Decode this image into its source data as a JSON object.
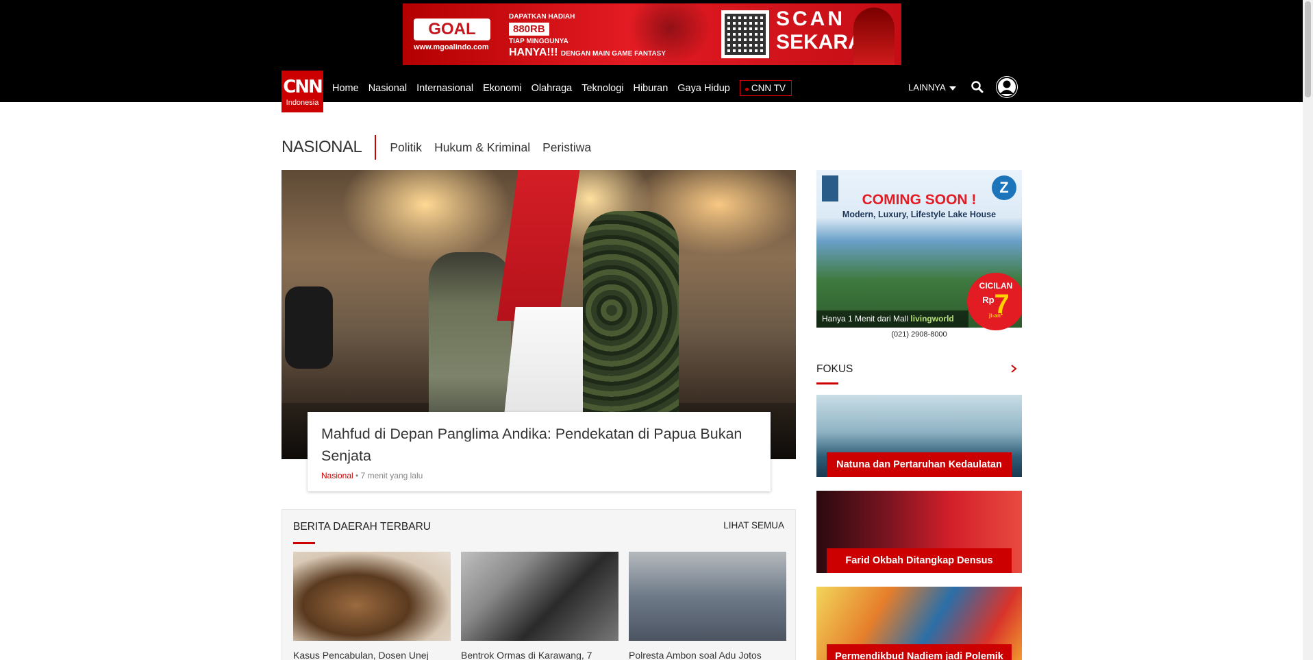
{
  "ad_top": {
    "logo": "GOAL",
    "site": "www.mgoalindo.com",
    "line1": "DAPATKAN HADIAH",
    "amount": "880RB",
    "line2": "TIAP MINGGUNYA",
    "line3": "HANYA!!!",
    "line3_small": "DENGAN MAIN GAME FANTASY",
    "scan": "SCAN",
    "sekarang": "SEKARANG"
  },
  "nav": {
    "logo_big": "CNN",
    "logo_small": "Indonesia",
    "links": [
      "Home",
      "Nasional",
      "Internasional",
      "Ekonomi",
      "Olahraga",
      "Teknologi",
      "Hiburan",
      "Gaya Hidup"
    ],
    "tv": "CNN TV",
    "more": "LAINNYA"
  },
  "section": {
    "title": "NASIONAL",
    "subs": [
      "Politik",
      "Hukum & Kriminal",
      "Peristiwa"
    ]
  },
  "hero": {
    "title": "Mahfud di Depan Panglima Andika: Pendekatan di Papua Bukan Senjata",
    "category": "Nasional",
    "time": "7 menit yang lalu"
  },
  "berita": {
    "title": "BERITA DAERAH TERBARU",
    "see_all": "LIHAT SEMUA",
    "items": [
      {
        "caption": "Kasus Pencabulan, Dosen Unej"
      },
      {
        "caption": "Bentrok Ormas di Karawang, 7"
      },
      {
        "caption": "Polresta Ambon soal Adu Jotos"
      }
    ]
  },
  "side_ad": {
    "coming": "COMING SOON !",
    "sub": "Modern, Luxury, Lifestyle Lake House",
    "z": "Z",
    "cicilan": "CICILAN",
    "rp": "Rp",
    "seven": "7",
    "jt": "jt-an*",
    "mall_text": "Hanya 1 Menit dari Mall",
    "mall_brand": "livingworld",
    "phone": "(021) 2908-8000"
  },
  "fokus": {
    "title": "FOKUS",
    "items": [
      {
        "label": "Natuna dan Pertaruhan Kedaulatan"
      },
      {
        "label": "Farid Okbah Ditangkap Densus"
      },
      {
        "label": "Permendikbud Nadiem jadi Polemik"
      }
    ]
  },
  "colors": {
    "brand_red": "#cc0000",
    "header_bg": "#000000"
  }
}
